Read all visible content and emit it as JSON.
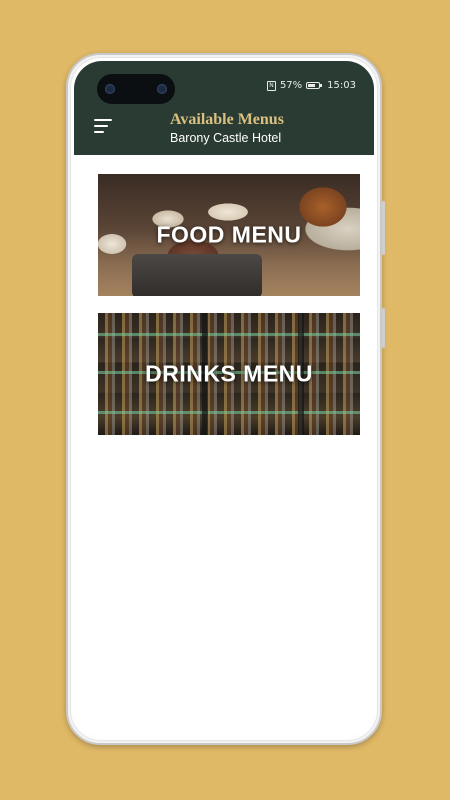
{
  "status_bar": {
    "nfc": "N",
    "battery": "57%",
    "time": "15:03"
  },
  "app_bar": {
    "menu_icon": "hamburger-menu-icon",
    "title": "Available Menus",
    "subtitle": "Barony Castle Hotel"
  },
  "menus": [
    {
      "label": "FOOD MENU"
    },
    {
      "label": "DRINKS MENU"
    }
  ],
  "colors": {
    "background": "#e0b966",
    "app_bar": "#2a3b33",
    "title": "#d9c07e",
    "subtitle": "#ffffff"
  }
}
